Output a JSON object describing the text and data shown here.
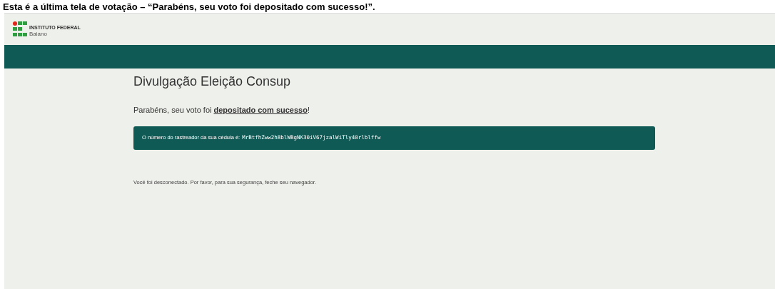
{
  "caption": "Esta é a última tela de votação – “Parabéns, seu voto foi depositado com sucesso!”.",
  "header": {
    "logo_title": "INSTITUTO FEDERAL",
    "logo_subtitle": "Baiano"
  },
  "page": {
    "title": "Divulgação Eleição Consup",
    "message": "Parabéns, seu voto foi **depositado com sucesso**!",
    "tracker_label": "O número do rastreador da sua cédula é:",
    "tracker_code": "MrBtfhZww2h8blWBgNK30iV67jzalWiTly40rlblffw",
    "logout_notice": "Você foi desconectado. Por favor, para sua segurança, feche seu navegador."
  }
}
